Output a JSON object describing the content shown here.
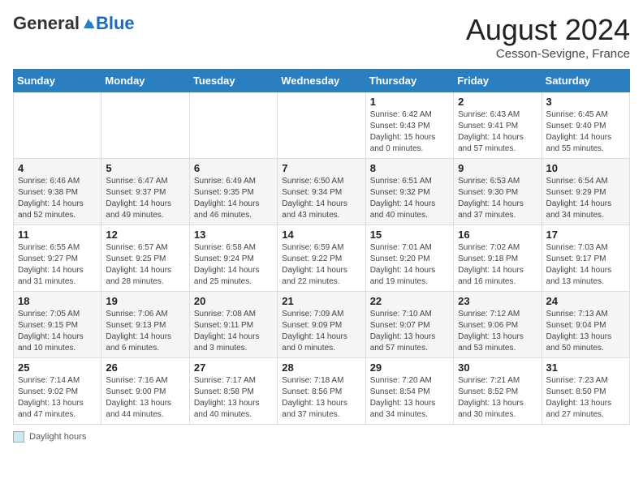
{
  "header": {
    "logo_general": "General",
    "logo_blue": "Blue",
    "month_title": "August 2024",
    "location": "Cesson-Sevigne, France"
  },
  "calendar": {
    "days_of_week": [
      "Sunday",
      "Monday",
      "Tuesday",
      "Wednesday",
      "Thursday",
      "Friday",
      "Saturday"
    ],
    "weeks": [
      [
        {
          "day": "",
          "info": ""
        },
        {
          "day": "",
          "info": ""
        },
        {
          "day": "",
          "info": ""
        },
        {
          "day": "",
          "info": ""
        },
        {
          "day": "1",
          "info": "Sunrise: 6:42 AM\nSunset: 9:43 PM\nDaylight: 15 hours and 0 minutes."
        },
        {
          "day": "2",
          "info": "Sunrise: 6:43 AM\nSunset: 9:41 PM\nDaylight: 14 hours and 57 minutes."
        },
        {
          "day": "3",
          "info": "Sunrise: 6:45 AM\nSunset: 9:40 PM\nDaylight: 14 hours and 55 minutes."
        }
      ],
      [
        {
          "day": "4",
          "info": "Sunrise: 6:46 AM\nSunset: 9:38 PM\nDaylight: 14 hours and 52 minutes."
        },
        {
          "day": "5",
          "info": "Sunrise: 6:47 AM\nSunset: 9:37 PM\nDaylight: 14 hours and 49 minutes."
        },
        {
          "day": "6",
          "info": "Sunrise: 6:49 AM\nSunset: 9:35 PM\nDaylight: 14 hours and 46 minutes."
        },
        {
          "day": "7",
          "info": "Sunrise: 6:50 AM\nSunset: 9:34 PM\nDaylight: 14 hours and 43 minutes."
        },
        {
          "day": "8",
          "info": "Sunrise: 6:51 AM\nSunset: 9:32 PM\nDaylight: 14 hours and 40 minutes."
        },
        {
          "day": "9",
          "info": "Sunrise: 6:53 AM\nSunset: 9:30 PM\nDaylight: 14 hours and 37 minutes."
        },
        {
          "day": "10",
          "info": "Sunrise: 6:54 AM\nSunset: 9:29 PM\nDaylight: 14 hours and 34 minutes."
        }
      ],
      [
        {
          "day": "11",
          "info": "Sunrise: 6:55 AM\nSunset: 9:27 PM\nDaylight: 14 hours and 31 minutes."
        },
        {
          "day": "12",
          "info": "Sunrise: 6:57 AM\nSunset: 9:25 PM\nDaylight: 14 hours and 28 minutes."
        },
        {
          "day": "13",
          "info": "Sunrise: 6:58 AM\nSunset: 9:24 PM\nDaylight: 14 hours and 25 minutes."
        },
        {
          "day": "14",
          "info": "Sunrise: 6:59 AM\nSunset: 9:22 PM\nDaylight: 14 hours and 22 minutes."
        },
        {
          "day": "15",
          "info": "Sunrise: 7:01 AM\nSunset: 9:20 PM\nDaylight: 14 hours and 19 minutes."
        },
        {
          "day": "16",
          "info": "Sunrise: 7:02 AM\nSunset: 9:18 PM\nDaylight: 14 hours and 16 minutes."
        },
        {
          "day": "17",
          "info": "Sunrise: 7:03 AM\nSunset: 9:17 PM\nDaylight: 14 hours and 13 minutes."
        }
      ],
      [
        {
          "day": "18",
          "info": "Sunrise: 7:05 AM\nSunset: 9:15 PM\nDaylight: 14 hours and 10 minutes."
        },
        {
          "day": "19",
          "info": "Sunrise: 7:06 AM\nSunset: 9:13 PM\nDaylight: 14 hours and 6 minutes."
        },
        {
          "day": "20",
          "info": "Sunrise: 7:08 AM\nSunset: 9:11 PM\nDaylight: 14 hours and 3 minutes."
        },
        {
          "day": "21",
          "info": "Sunrise: 7:09 AM\nSunset: 9:09 PM\nDaylight: 14 hours and 0 minutes."
        },
        {
          "day": "22",
          "info": "Sunrise: 7:10 AM\nSunset: 9:07 PM\nDaylight: 13 hours and 57 minutes."
        },
        {
          "day": "23",
          "info": "Sunrise: 7:12 AM\nSunset: 9:06 PM\nDaylight: 13 hours and 53 minutes."
        },
        {
          "day": "24",
          "info": "Sunrise: 7:13 AM\nSunset: 9:04 PM\nDaylight: 13 hours and 50 minutes."
        }
      ],
      [
        {
          "day": "25",
          "info": "Sunrise: 7:14 AM\nSunset: 9:02 PM\nDaylight: 13 hours and 47 minutes."
        },
        {
          "day": "26",
          "info": "Sunrise: 7:16 AM\nSunset: 9:00 PM\nDaylight: 13 hours and 44 minutes."
        },
        {
          "day": "27",
          "info": "Sunrise: 7:17 AM\nSunset: 8:58 PM\nDaylight: 13 hours and 40 minutes."
        },
        {
          "day": "28",
          "info": "Sunrise: 7:18 AM\nSunset: 8:56 PM\nDaylight: 13 hours and 37 minutes."
        },
        {
          "day": "29",
          "info": "Sunrise: 7:20 AM\nSunset: 8:54 PM\nDaylight: 13 hours and 34 minutes."
        },
        {
          "day": "30",
          "info": "Sunrise: 7:21 AM\nSunset: 8:52 PM\nDaylight: 13 hours and 30 minutes."
        },
        {
          "day": "31",
          "info": "Sunrise: 7:23 AM\nSunset: 8:50 PM\nDaylight: 13 hours and 27 minutes."
        }
      ]
    ]
  },
  "footer": {
    "daylight_label": "Daylight hours"
  }
}
